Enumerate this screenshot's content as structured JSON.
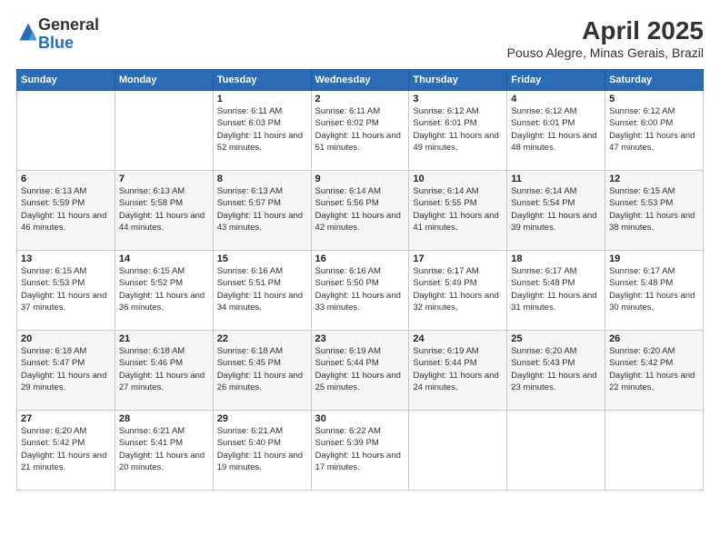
{
  "logo": {
    "general": "General",
    "blue": "Blue"
  },
  "title": "April 2025",
  "subtitle": "Pouso Alegre, Minas Gerais, Brazil",
  "headers": [
    "Sunday",
    "Monday",
    "Tuesday",
    "Wednesday",
    "Thursday",
    "Friday",
    "Saturday"
  ],
  "weeks": [
    [
      {
        "day": "",
        "sunrise": "",
        "sunset": "",
        "daylight": ""
      },
      {
        "day": "",
        "sunrise": "",
        "sunset": "",
        "daylight": ""
      },
      {
        "day": "1",
        "sunrise": "Sunrise: 6:11 AM",
        "sunset": "Sunset: 6:03 PM",
        "daylight": "Daylight: 11 hours and 52 minutes."
      },
      {
        "day": "2",
        "sunrise": "Sunrise: 6:11 AM",
        "sunset": "Sunset: 6:02 PM",
        "daylight": "Daylight: 11 hours and 51 minutes."
      },
      {
        "day": "3",
        "sunrise": "Sunrise: 6:12 AM",
        "sunset": "Sunset: 6:01 PM",
        "daylight": "Daylight: 11 hours and 49 minutes."
      },
      {
        "day": "4",
        "sunrise": "Sunrise: 6:12 AM",
        "sunset": "Sunset: 6:01 PM",
        "daylight": "Daylight: 11 hours and 48 minutes."
      },
      {
        "day": "5",
        "sunrise": "Sunrise: 6:12 AM",
        "sunset": "Sunset: 6:00 PM",
        "daylight": "Daylight: 11 hours and 47 minutes."
      }
    ],
    [
      {
        "day": "6",
        "sunrise": "Sunrise: 6:13 AM",
        "sunset": "Sunset: 5:59 PM",
        "daylight": "Daylight: 11 hours and 46 minutes."
      },
      {
        "day": "7",
        "sunrise": "Sunrise: 6:13 AM",
        "sunset": "Sunset: 5:58 PM",
        "daylight": "Daylight: 11 hours and 44 minutes."
      },
      {
        "day": "8",
        "sunrise": "Sunrise: 6:13 AM",
        "sunset": "Sunset: 5:57 PM",
        "daylight": "Daylight: 11 hours and 43 minutes."
      },
      {
        "day": "9",
        "sunrise": "Sunrise: 6:14 AM",
        "sunset": "Sunset: 5:56 PM",
        "daylight": "Daylight: 11 hours and 42 minutes."
      },
      {
        "day": "10",
        "sunrise": "Sunrise: 6:14 AM",
        "sunset": "Sunset: 5:55 PM",
        "daylight": "Daylight: 11 hours and 41 minutes."
      },
      {
        "day": "11",
        "sunrise": "Sunrise: 6:14 AM",
        "sunset": "Sunset: 5:54 PM",
        "daylight": "Daylight: 11 hours and 39 minutes."
      },
      {
        "day": "12",
        "sunrise": "Sunrise: 6:15 AM",
        "sunset": "Sunset: 5:53 PM",
        "daylight": "Daylight: 11 hours and 38 minutes."
      }
    ],
    [
      {
        "day": "13",
        "sunrise": "Sunrise: 6:15 AM",
        "sunset": "Sunset: 5:53 PM",
        "daylight": "Daylight: 11 hours and 37 minutes."
      },
      {
        "day": "14",
        "sunrise": "Sunrise: 6:15 AM",
        "sunset": "Sunset: 5:52 PM",
        "daylight": "Daylight: 11 hours and 36 minutes."
      },
      {
        "day": "15",
        "sunrise": "Sunrise: 6:16 AM",
        "sunset": "Sunset: 5:51 PM",
        "daylight": "Daylight: 11 hours and 34 minutes."
      },
      {
        "day": "16",
        "sunrise": "Sunrise: 6:16 AM",
        "sunset": "Sunset: 5:50 PM",
        "daylight": "Daylight: 11 hours and 33 minutes."
      },
      {
        "day": "17",
        "sunrise": "Sunrise: 6:17 AM",
        "sunset": "Sunset: 5:49 PM",
        "daylight": "Daylight: 11 hours and 32 minutes."
      },
      {
        "day": "18",
        "sunrise": "Sunrise: 6:17 AM",
        "sunset": "Sunset: 5:48 PM",
        "daylight": "Daylight: 11 hours and 31 minutes."
      },
      {
        "day": "19",
        "sunrise": "Sunrise: 6:17 AM",
        "sunset": "Sunset: 5:48 PM",
        "daylight": "Daylight: 11 hours and 30 minutes."
      }
    ],
    [
      {
        "day": "20",
        "sunrise": "Sunrise: 6:18 AM",
        "sunset": "Sunset: 5:47 PM",
        "daylight": "Daylight: 11 hours and 29 minutes."
      },
      {
        "day": "21",
        "sunrise": "Sunrise: 6:18 AM",
        "sunset": "Sunset: 5:46 PM",
        "daylight": "Daylight: 11 hours and 27 minutes."
      },
      {
        "day": "22",
        "sunrise": "Sunrise: 6:18 AM",
        "sunset": "Sunset: 5:45 PM",
        "daylight": "Daylight: 11 hours and 26 minutes."
      },
      {
        "day": "23",
        "sunrise": "Sunrise: 6:19 AM",
        "sunset": "Sunset: 5:44 PM",
        "daylight": "Daylight: 11 hours and 25 minutes."
      },
      {
        "day": "24",
        "sunrise": "Sunrise: 6:19 AM",
        "sunset": "Sunset: 5:44 PM",
        "daylight": "Daylight: 11 hours and 24 minutes."
      },
      {
        "day": "25",
        "sunrise": "Sunrise: 6:20 AM",
        "sunset": "Sunset: 5:43 PM",
        "daylight": "Daylight: 11 hours and 23 minutes."
      },
      {
        "day": "26",
        "sunrise": "Sunrise: 6:20 AM",
        "sunset": "Sunset: 5:42 PM",
        "daylight": "Daylight: 11 hours and 22 minutes."
      }
    ],
    [
      {
        "day": "27",
        "sunrise": "Sunrise: 6:20 AM",
        "sunset": "Sunset: 5:42 PM",
        "daylight": "Daylight: 11 hours and 21 minutes."
      },
      {
        "day": "28",
        "sunrise": "Sunrise: 6:21 AM",
        "sunset": "Sunset: 5:41 PM",
        "daylight": "Daylight: 11 hours and 20 minutes."
      },
      {
        "day": "29",
        "sunrise": "Sunrise: 6:21 AM",
        "sunset": "Sunset: 5:40 PM",
        "daylight": "Daylight: 11 hours and 19 minutes."
      },
      {
        "day": "30",
        "sunrise": "Sunrise: 6:22 AM",
        "sunset": "Sunset: 5:39 PM",
        "daylight": "Daylight: 11 hours and 17 minutes."
      },
      {
        "day": "",
        "sunrise": "",
        "sunset": "",
        "daylight": ""
      },
      {
        "day": "",
        "sunrise": "",
        "sunset": "",
        "daylight": ""
      },
      {
        "day": "",
        "sunrise": "",
        "sunset": "",
        "daylight": ""
      }
    ]
  ]
}
